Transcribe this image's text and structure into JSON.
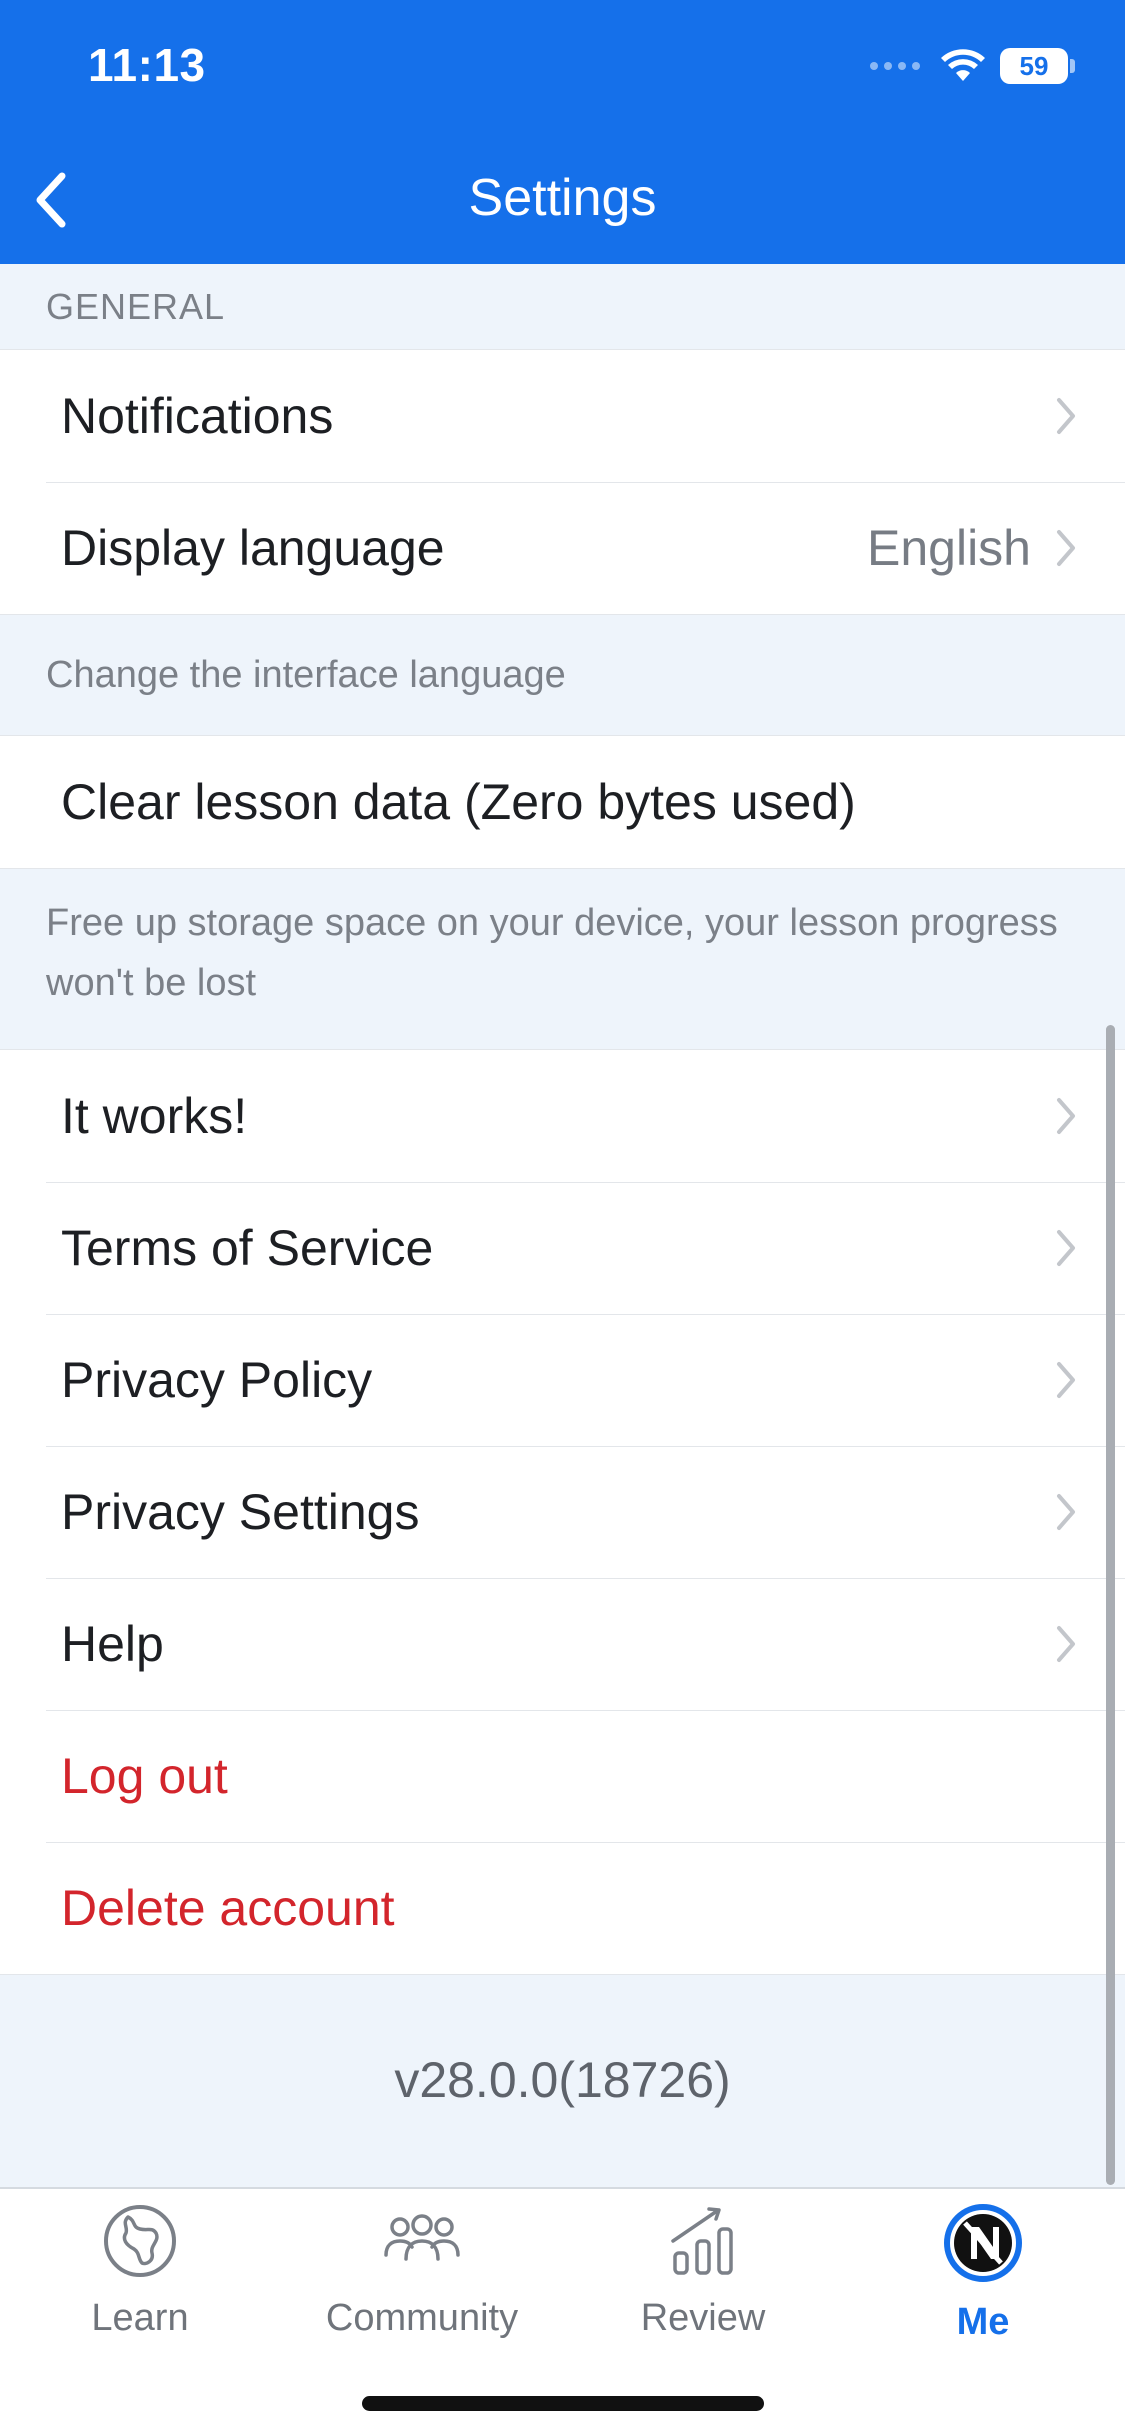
{
  "status_bar": {
    "time": "11:13",
    "battery": "59"
  },
  "header": {
    "title": "Settings"
  },
  "general": {
    "header": "GENERAL",
    "notifications": "Notifications",
    "display_language": {
      "label": "Display language",
      "value": "English"
    },
    "language_note": "Change the interface language"
  },
  "storage": {
    "clear_label": "Clear lesson data (Zero bytes used)",
    "note": "Free up storage space on your device, your lesson progress won't be lost"
  },
  "links": {
    "it_works": "It works!",
    "terms": "Terms of Service",
    "privacy_policy": "Privacy Policy",
    "privacy_settings": "Privacy Settings",
    "help": "Help",
    "log_out": "Log out",
    "delete_account": "Delete account"
  },
  "version": "v28.0.0(18726)",
  "tabbar": {
    "learn": "Learn",
    "community": "Community",
    "review": "Review",
    "me": "Me",
    "active": "me"
  },
  "colors": {
    "brand": "#1570EA",
    "danger": "#D3252C"
  }
}
